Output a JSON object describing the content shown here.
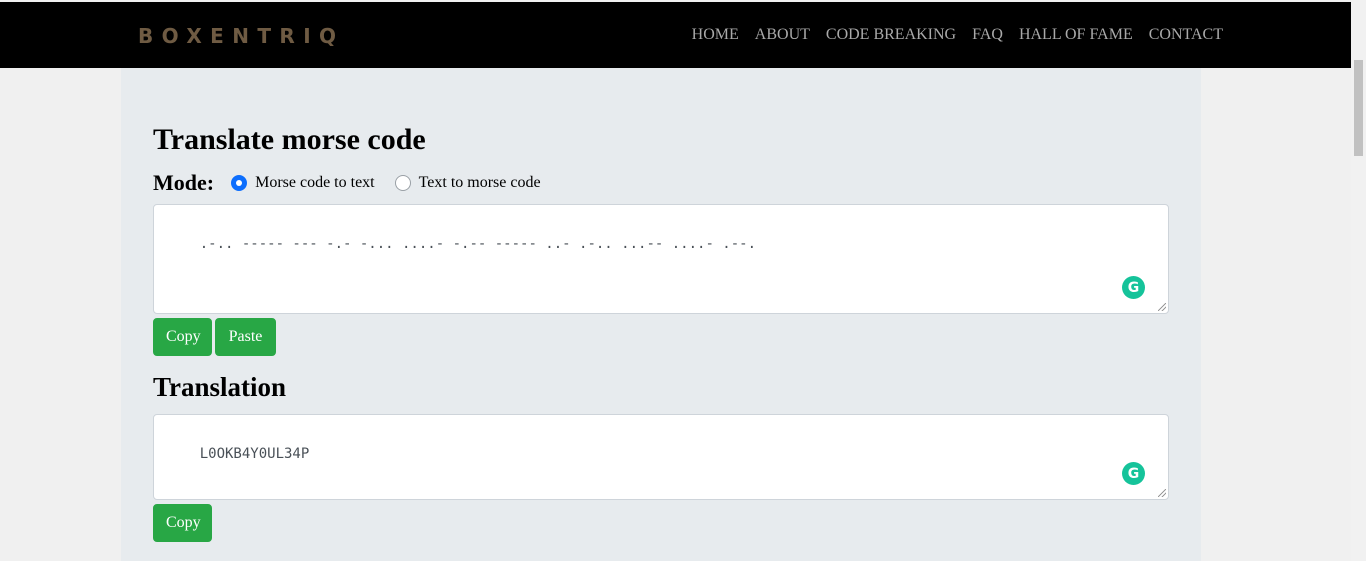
{
  "nav": {
    "brand": "BOXENTRIQ",
    "links": [
      "HOME",
      "ABOUT",
      "CODE BREAKING",
      "FAQ",
      "HALL OF FAME",
      "CONTACT"
    ]
  },
  "main": {
    "title": "Translate morse code",
    "mode": {
      "label": "Mode:",
      "options": [
        "Morse code to text",
        "Text to morse code"
      ],
      "selected": "Morse code to text"
    },
    "input": {
      "value": ".-.. ----- --- -.- -... ....- -.-- ----- ..- .-.. ...-- ....- .--."
    },
    "input_buttons": {
      "copy": "Copy",
      "paste": "Paste"
    },
    "translation_title": "Translation",
    "output": {
      "value": "L0OKB4Y0UL34P"
    },
    "output_buttons": {
      "copy": "Copy"
    }
  },
  "icons": {
    "grammarly": "grammarly-icon"
  },
  "colors": {
    "navbar_bg": "#000000",
    "brand": "#6f5b43",
    "nav_link": "#a9a9a9",
    "content_bg": "#e7ebee",
    "button": "#28a745",
    "radio_checked": "#0d6efd",
    "grammarly": "#15c39a"
  }
}
